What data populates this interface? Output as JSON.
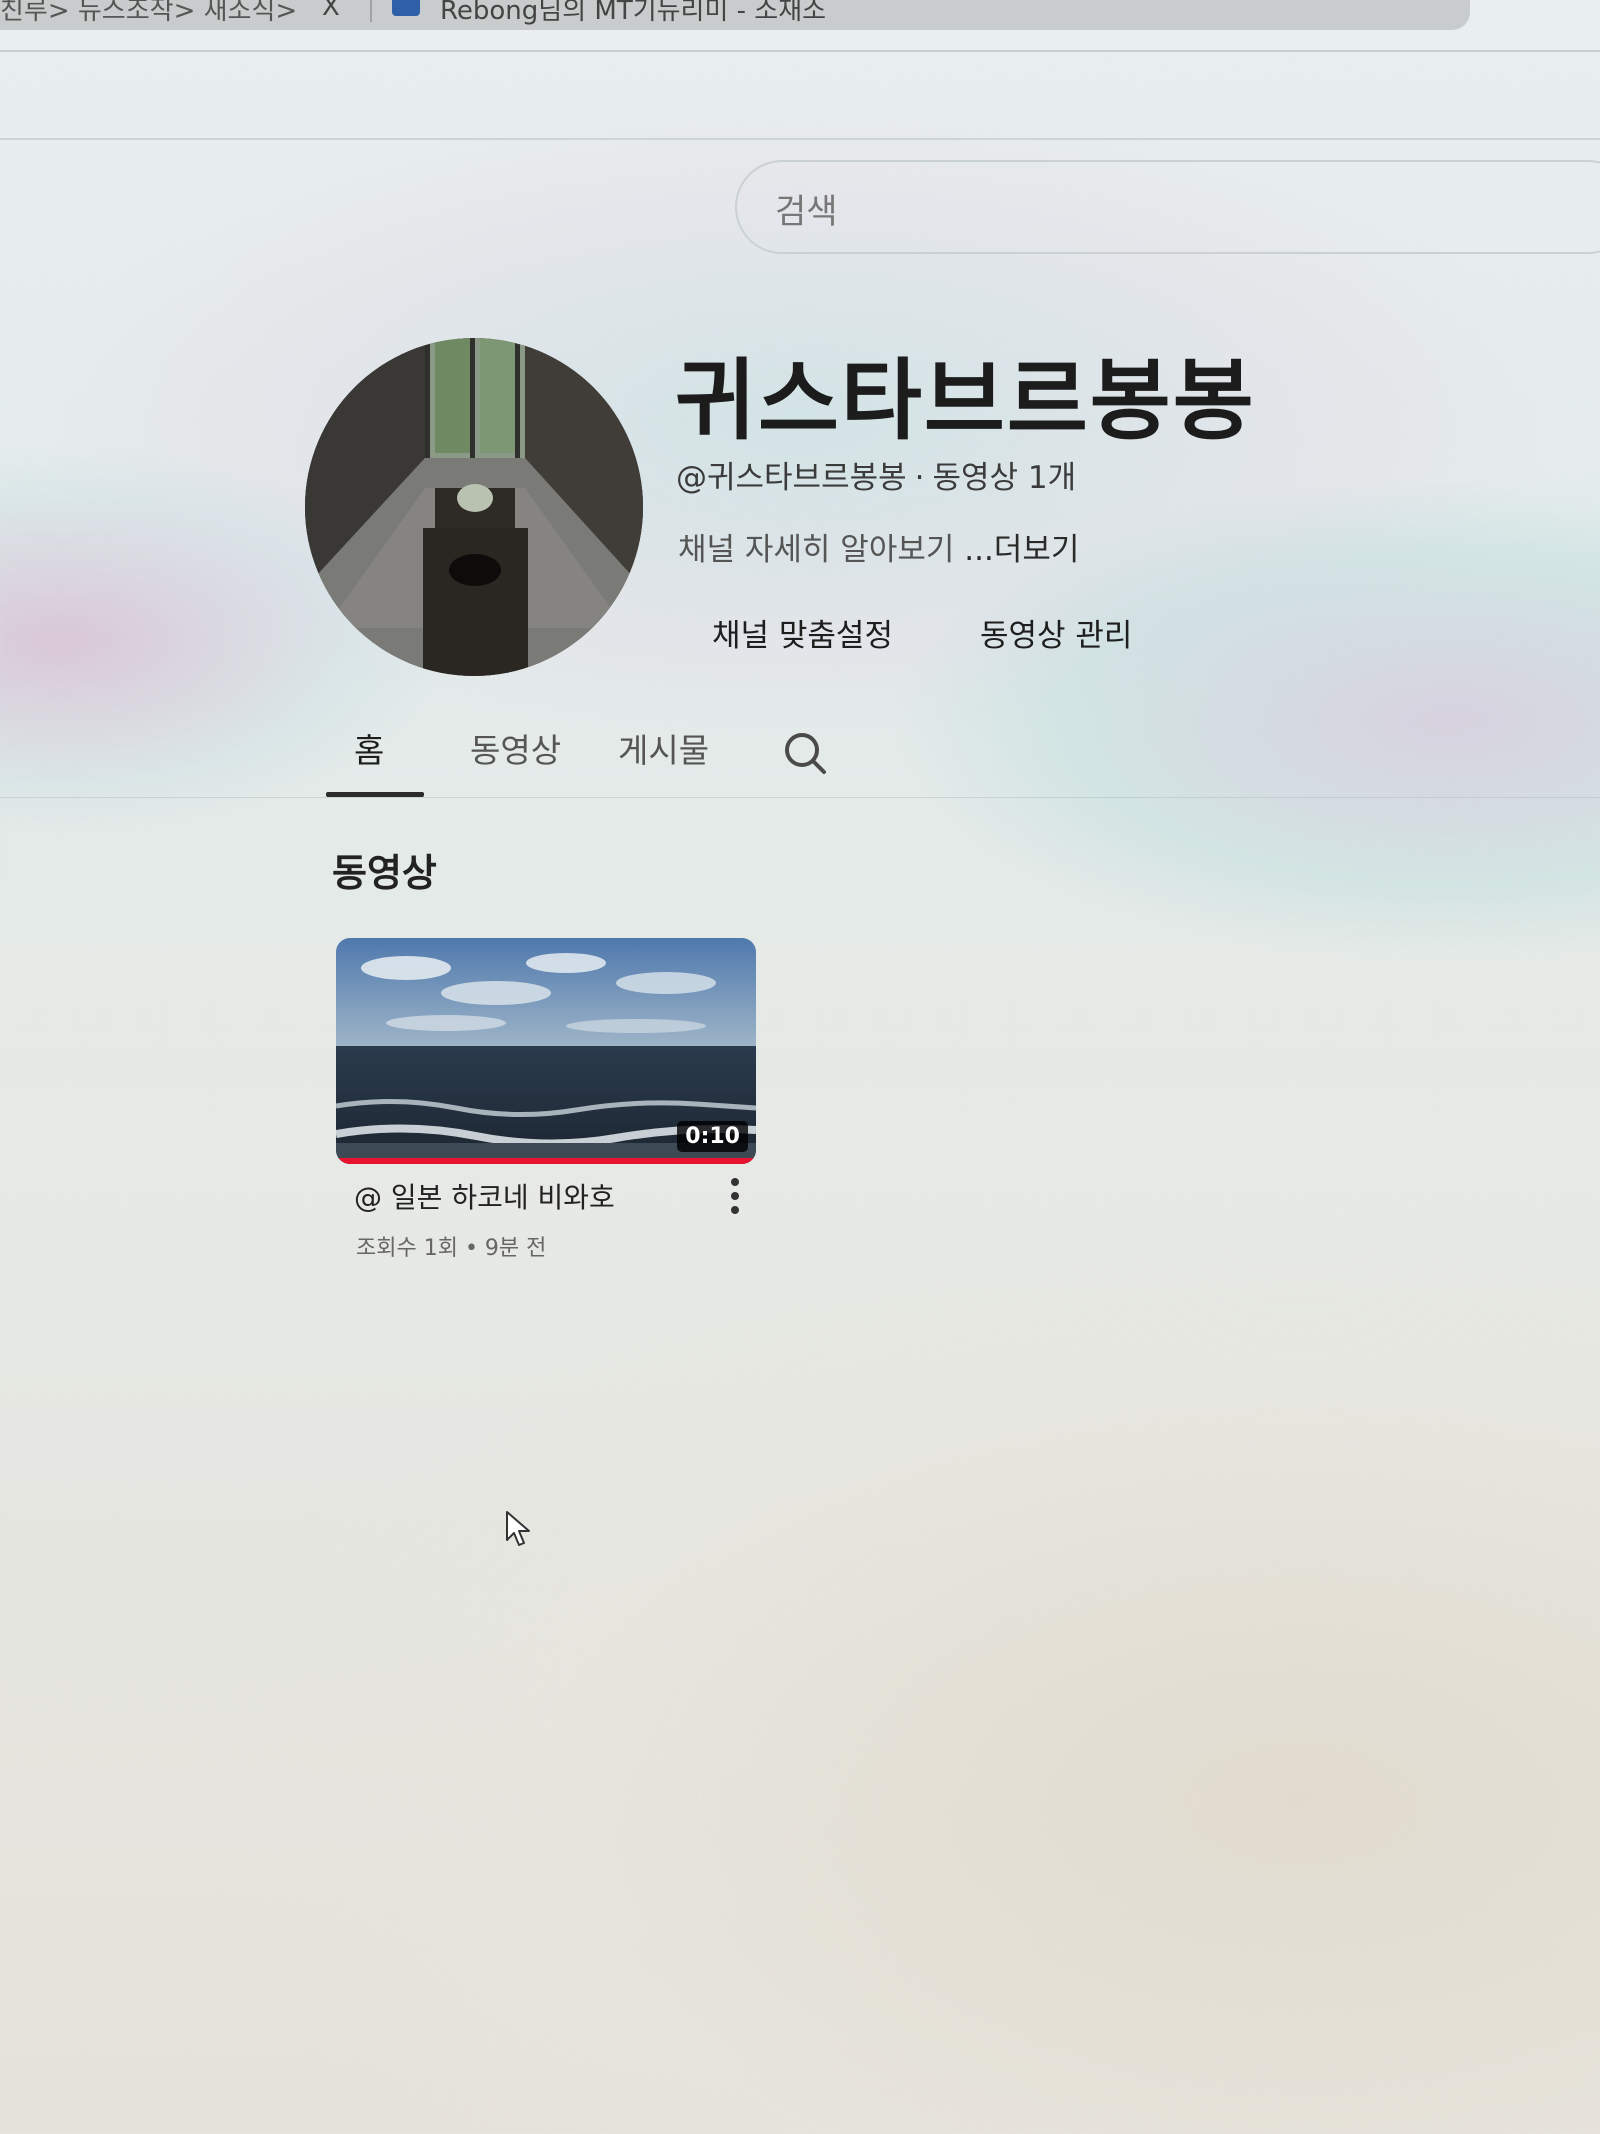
{
  "browser": {
    "breadcrumb": "친루> 뉴스조작> 새소식>",
    "close_glyph": "X",
    "tab_title": "Rebong님의 MT기뉴리미 - 소재소"
  },
  "search": {
    "placeholder": "검색"
  },
  "channel": {
    "name": "귀스타브르봉봉",
    "handle": "@귀스타브르봉봉",
    "separator": "·",
    "video_count": "동영상 1개",
    "description": "채널 자세히 알아보기",
    "more_label": "...더보기",
    "customize_button": "채널 맞춤설정",
    "manage_button": "동영상 관리"
  },
  "tabs": {
    "home": "홈",
    "videos": "동영상",
    "posts": "게시물",
    "search_icon": "search-icon",
    "active": "home"
  },
  "section": {
    "title": "동영상"
  },
  "videos": [
    {
      "title": "@ 일본 하코네 비와호",
      "duration": "0:10",
      "meta": "조회수 1회 • 9분 전",
      "watched_fraction": 1.0,
      "menu_icon": "more-vert-icon"
    }
  ],
  "colors": {
    "progress": "#e8132e",
    "text_primary": "#1c1c1c",
    "text_secondary": "#555555"
  }
}
